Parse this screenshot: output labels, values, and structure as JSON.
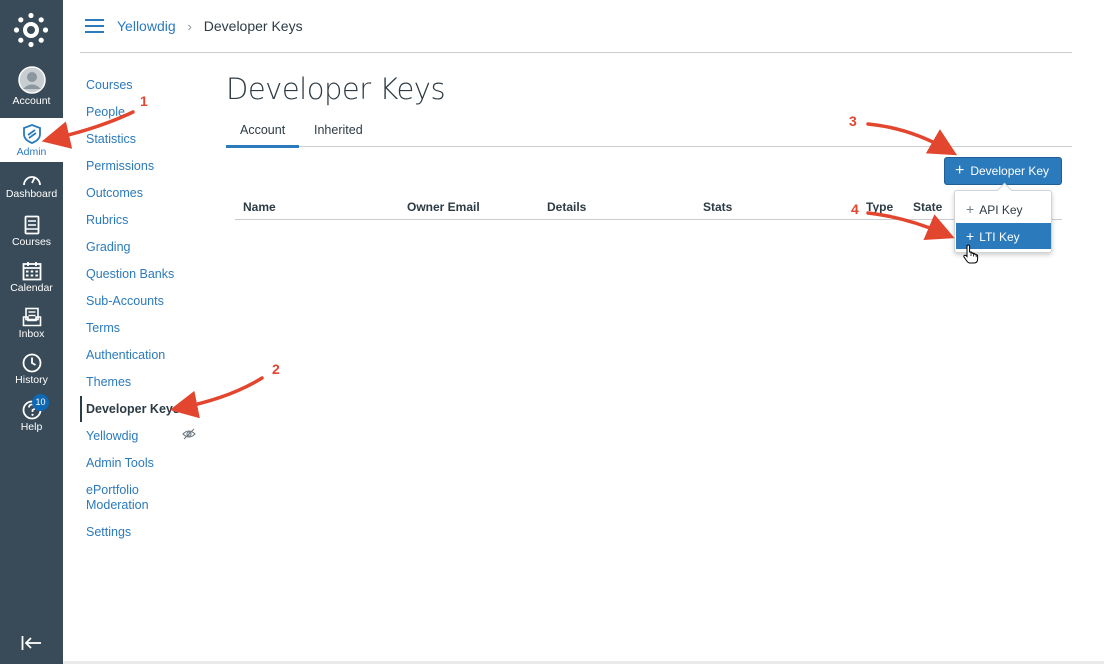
{
  "global_nav": {
    "items": [
      {
        "label": "Account",
        "icon": "user-avatar-icon"
      },
      {
        "label": "Admin",
        "icon": "shield-icon"
      },
      {
        "label": "Dashboard",
        "icon": "dashboard-icon"
      },
      {
        "label": "Courses",
        "icon": "courses-book-icon"
      },
      {
        "label": "Calendar",
        "icon": "calendar-icon"
      },
      {
        "label": "Inbox",
        "icon": "inbox-icon"
      },
      {
        "label": "History",
        "icon": "clock-icon"
      },
      {
        "label": "Help",
        "icon": "help-icon"
      }
    ],
    "help_badge": "10",
    "active": "Admin"
  },
  "breadcrumb": {
    "account": "Yellowdig",
    "separator": "›",
    "current": "Developer Keys"
  },
  "sidebar": {
    "items": [
      {
        "label": "Courses"
      },
      {
        "label": "People"
      },
      {
        "label": "Statistics"
      },
      {
        "label": "Permissions"
      },
      {
        "label": "Outcomes"
      },
      {
        "label": "Rubrics"
      },
      {
        "label": "Grading"
      },
      {
        "label": "Question Banks"
      },
      {
        "label": "Sub-Accounts"
      },
      {
        "label": "Terms"
      },
      {
        "label": "Authentication"
      },
      {
        "label": "Themes"
      },
      {
        "label": "Developer Keys"
      },
      {
        "label": "Yellowdig"
      },
      {
        "label": "Admin Tools"
      },
      {
        "label": "ePortfolio\nModeration"
      },
      {
        "label": "Settings"
      }
    ],
    "active": "Developer Keys"
  },
  "page": {
    "title": "Developer Keys",
    "tabs": [
      {
        "label": "Account"
      },
      {
        "label": "Inherited"
      }
    ],
    "active_tab": "Account",
    "add_button": "Developer Key",
    "table_headers": [
      "Name",
      "Owner Email",
      "Details",
      "Stats",
      "Type",
      "State"
    ],
    "dropdown": [
      {
        "label": "API Key"
      },
      {
        "label": "LTI Key"
      }
    ],
    "dropdown_hover": "LTI Key"
  },
  "annotations": [
    "1",
    "2",
    "3",
    "4"
  ],
  "colors": {
    "nav_bg": "#394b58",
    "brand_blue": "#2b7abc",
    "annotation_red": "#e2462f"
  }
}
